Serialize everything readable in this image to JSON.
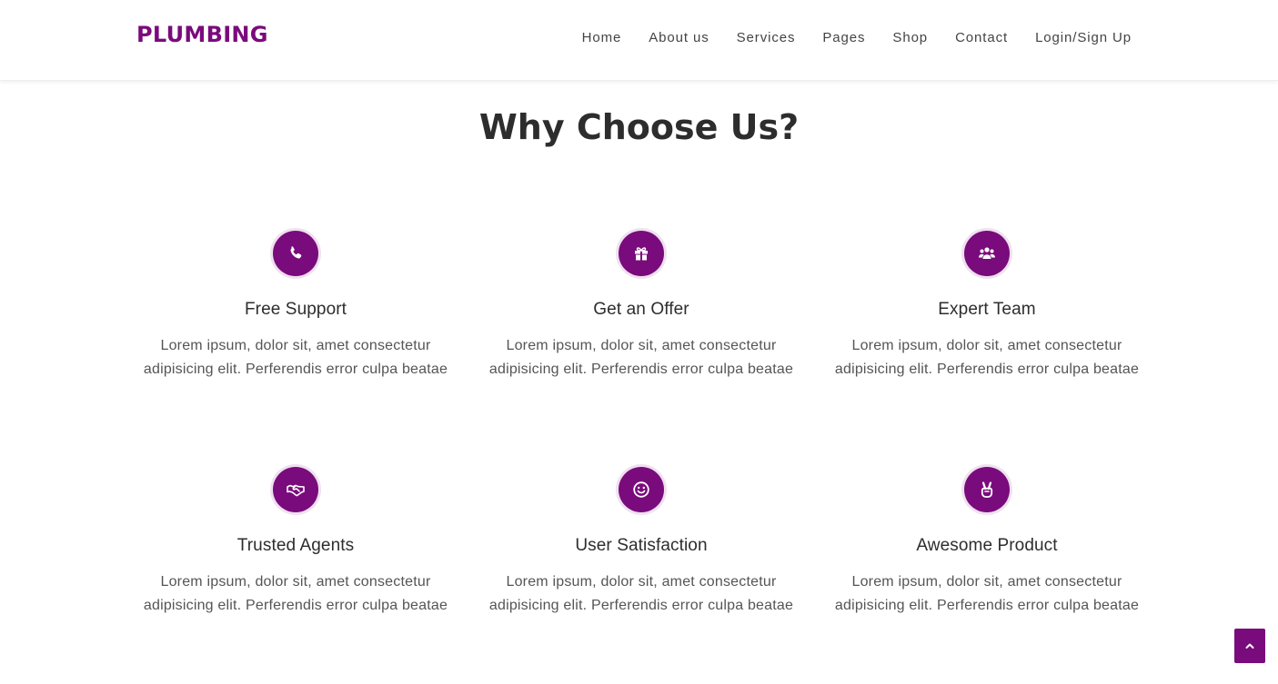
{
  "brand": {
    "logo": "PLUMBING",
    "accent_color": "#7a0b7c"
  },
  "nav": {
    "items": [
      {
        "label": "Home"
      },
      {
        "label": "About us"
      },
      {
        "label": "Services"
      },
      {
        "label": "Pages"
      },
      {
        "label": "Shop"
      },
      {
        "label": "Contact"
      },
      {
        "label": "Login/Sign Up"
      }
    ]
  },
  "section": {
    "title": "Why Choose Us?",
    "features": [
      {
        "icon": "phone-icon",
        "title": "Free Support",
        "line1": "Lorem ipsum, dolor sit, amet consectetur",
        "line2": "adipisicing elit. Perferendis error culpa beatae"
      },
      {
        "icon": "gift-icon",
        "title": "Get an Offer",
        "line1": "Lorem ipsum, dolor sit, amet consectetur",
        "line2": "adipisicing elit. Perferendis error culpa beatae"
      },
      {
        "icon": "users-icon",
        "title": "Expert Team",
        "line1": "Lorem ipsum, dolor sit, amet consectetur",
        "line2": "adipisicing elit. Perferendis error culpa beatae"
      },
      {
        "icon": "handshake-icon",
        "title": "Trusted Agents",
        "line1": "Lorem ipsum, dolor sit, amet consectetur",
        "line2": "adipisicing elit. Perferendis error culpa beatae"
      },
      {
        "icon": "smile-icon",
        "title": "User Satisfaction",
        "line1": "Lorem ipsum, dolor sit, amet consectetur",
        "line2": "adipisicing elit. Perferendis error culpa beatae"
      },
      {
        "icon": "victory-hand-icon",
        "title": "Awesome Product",
        "line1": "Lorem ipsum, dolor sit, amet consectetur",
        "line2": "adipisicing elit. Perferendis error culpa beatae"
      }
    ]
  },
  "scroll_top": {
    "icon": "chevron-up-icon"
  }
}
